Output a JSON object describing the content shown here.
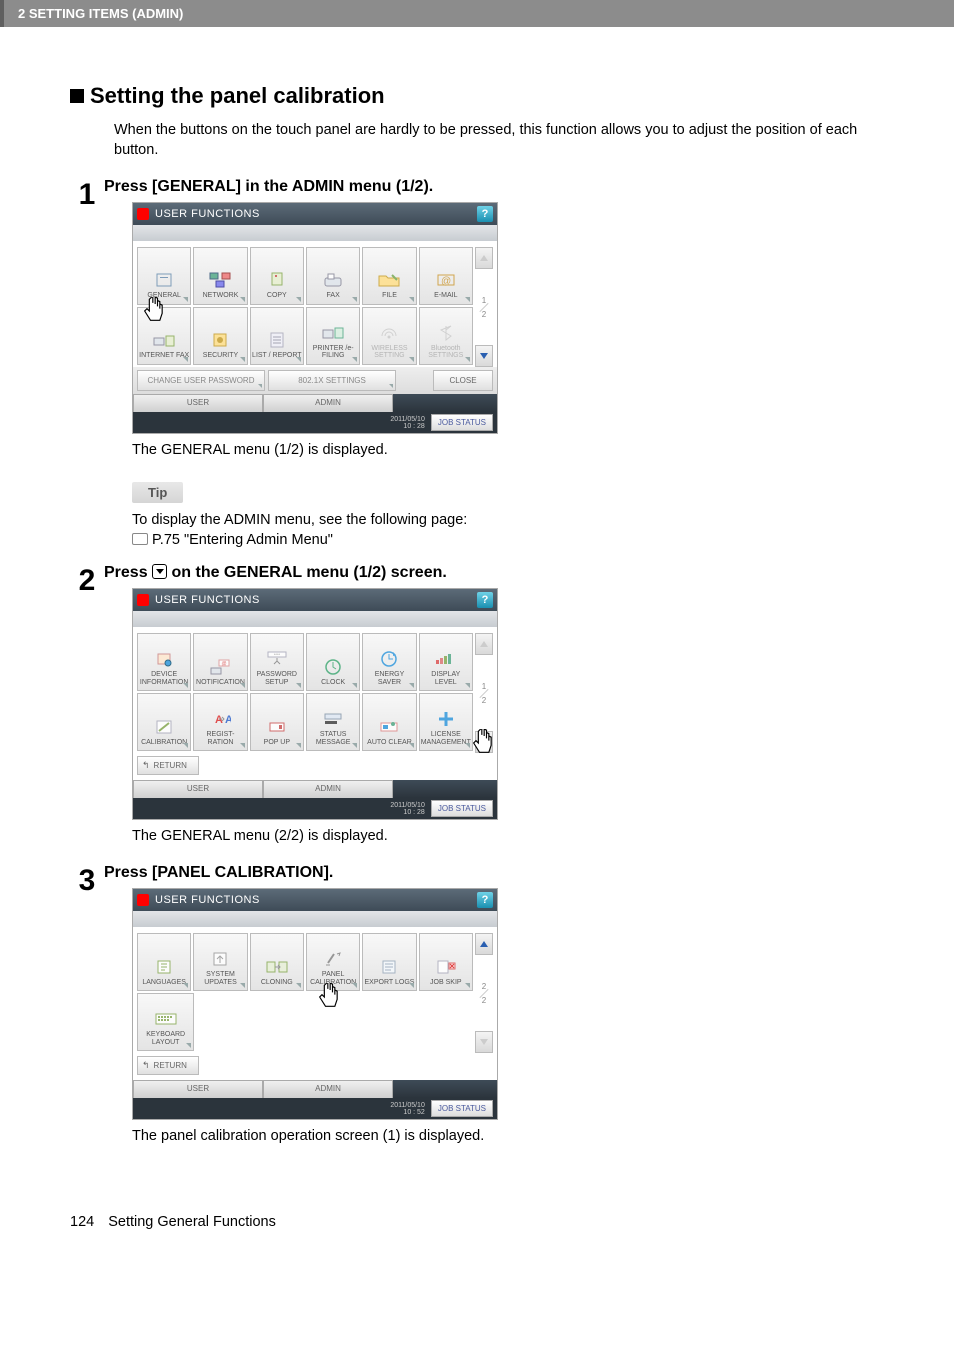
{
  "header": {
    "label": "2 SETTING ITEMS (ADMIN)"
  },
  "section": {
    "title": "Setting the panel calibration",
    "intro": "When the buttons on the touch panel are hardly to be pressed, this function allows you to adjust the position of each button."
  },
  "panel_header_title": "USER FUNCTIONS",
  "help_icon": "?",
  "close_label": "CLOSE",
  "return_label": "RETURN",
  "job_status_label": "JOB STATUS",
  "tabs": {
    "user": "USER",
    "admin": "ADMIN"
  },
  "page_indicator": {
    "top": "1",
    "bottom": "2",
    "top2": "2",
    "bottom2": "2"
  },
  "steps": {
    "s1": {
      "num": "1",
      "head": "Press [GENERAL] in the ADMIN menu (1/2).",
      "caption": "The GENERAL menu (1/2) is displayed.",
      "tiles_row1": [
        "GENERAL",
        "NETWORK",
        "COPY",
        "FAX",
        "FILE",
        "E-MAIL"
      ],
      "tiles_row2": [
        "INTERNET FAX",
        "SECURITY",
        "LIST / REPORT",
        "PRINTER /e-FILING",
        "WIRELESS SETTING",
        "Bluetooth SETTINGS"
      ],
      "winbtns": [
        "CHANGE USER PASSWORD",
        "802.1X SETTINGS"
      ],
      "timestamp": "2011/05/10\n10 : 28"
    },
    "tip": {
      "label": "Tip",
      "line1": "To display the ADMIN menu, see the following page:",
      "line2": "P.75 \"Entering Admin Menu\""
    },
    "s2": {
      "num": "2",
      "head_pre": "Press ",
      "head_post": " on the GENERAL menu (1/2) screen.",
      "caption": "The GENERAL menu (2/2) is displayed.",
      "tiles_row1": [
        "DEVICE INFORMATION",
        "NOTIFICATION",
        "PASSWORD SETUP",
        "CLOCK",
        "ENERGY SAVER",
        "DISPLAY LEVEL"
      ],
      "tiles_row2": [
        "CALIBRATION",
        "REGIST-RATION",
        "POP UP",
        "STATUS MESSAGE",
        "AUTO CLEAR",
        "LICENSE MANAGEMENT"
      ],
      "timestamp": "2011/05/10\n10 : 28"
    },
    "s3": {
      "num": "3",
      "head": "Press [PANEL CALIBRATION].",
      "caption": "The panel calibration operation screen (1) is displayed.",
      "tiles_row1": [
        "LANGUAGES",
        "SYSTEM UPDATES",
        "CLONING",
        "PANEL CALIBRATION",
        "EXPORT LOGS",
        "JOB SKIP"
      ],
      "tiles_row2": [
        "KEYBOARD LAYOUT"
      ],
      "timestamp": "2011/05/10\n10 : 52"
    }
  },
  "footer": {
    "pagenum": "124",
    "section_name": "Setting General Functions"
  }
}
